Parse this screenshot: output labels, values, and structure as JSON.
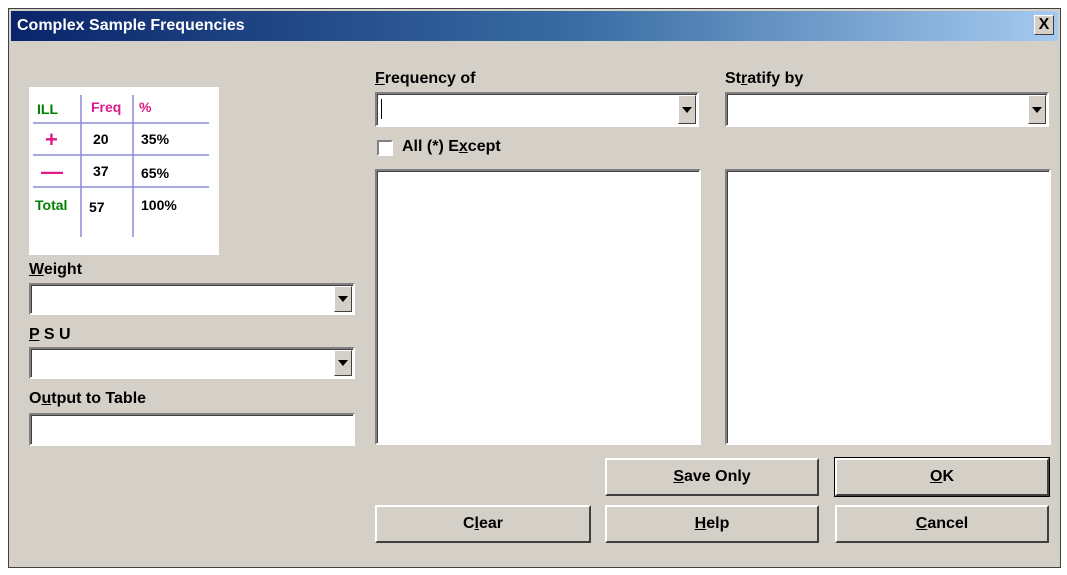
{
  "window": {
    "title": "Complex Sample Frequencies",
    "close_label": "X"
  },
  "logo": {
    "header": [
      "ILL",
      "Freq",
      "%"
    ],
    "rows": [
      {
        "label": "+",
        "freq": "20",
        "pct": "35%"
      },
      {
        "label": "—",
        "freq": "37",
        "pct": "65%"
      },
      {
        "label": "Total",
        "freq": "57",
        "pct": "100%"
      }
    ],
    "colors": {
      "green": "#008000",
      "pink": "#e0198a",
      "rule": "#8c8cd8"
    }
  },
  "fields": {
    "frequency_of": {
      "pre": "",
      "ul": "F",
      "post": "requency of",
      "value": ""
    },
    "stratify_by": {
      "pre": "St",
      "ul": "r",
      "post": "atify by",
      "value": ""
    },
    "all_except": {
      "pre": "All (*) E",
      "ul": "x",
      "post": "cept",
      "checked": false
    },
    "weight": {
      "pre": "",
      "ul": "W",
      "post": "eight",
      "value": ""
    },
    "psu": {
      "pre": "",
      "ul": "P",
      "post": " S U",
      "value": ""
    },
    "output_table": {
      "pre": "O",
      "ul": "u",
      "post": "tput to Table",
      "value": ""
    }
  },
  "buttons": {
    "save_only": {
      "ul": "S",
      "post": "ave Only"
    },
    "ok": {
      "ul": "O",
      "post": "K"
    },
    "clear": {
      "pre": "C",
      "ul": "l",
      "post": "ear"
    },
    "help": {
      "ul": "H",
      "post": "elp"
    },
    "cancel": {
      "ul": "C",
      "post": "ancel"
    }
  }
}
